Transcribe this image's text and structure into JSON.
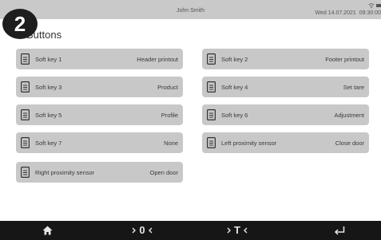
{
  "status": {
    "user": "John Smith",
    "date": "Wed 14.07.2021",
    "time": "09:30:00"
  },
  "badge": "2",
  "page_title": "Buttons",
  "keys": [
    {
      "label": "Soft key 1",
      "value": "Header printout"
    },
    {
      "label": "Soft key 2",
      "value": "Footer printout"
    },
    {
      "label": "Soft key 3",
      "value": "Product"
    },
    {
      "label": "Soft key 4",
      "value": "Set tare"
    },
    {
      "label": "Soft key 5",
      "value": "Profile"
    },
    {
      "label": "Soft key 6",
      "value": "Adjustment"
    },
    {
      "label": "Soft key 7",
      "value": "None"
    },
    {
      "label": "Left proximity sensor",
      "value": "Close door"
    },
    {
      "label": "Right proximity sensor",
      "value": "Open door"
    }
  ],
  "nav": {
    "home_icon": "home-icon",
    "zero_icon": "zero-icon",
    "tare_icon": "tare-icon",
    "enter_icon": "enter-icon",
    "zero_label": "0",
    "tare_label": "T"
  },
  "colors": {
    "statusbar": "#c9c9c9",
    "key_bg": "#c8c8c8",
    "navbar": "#161616",
    "badge": "#1e1e1e"
  }
}
